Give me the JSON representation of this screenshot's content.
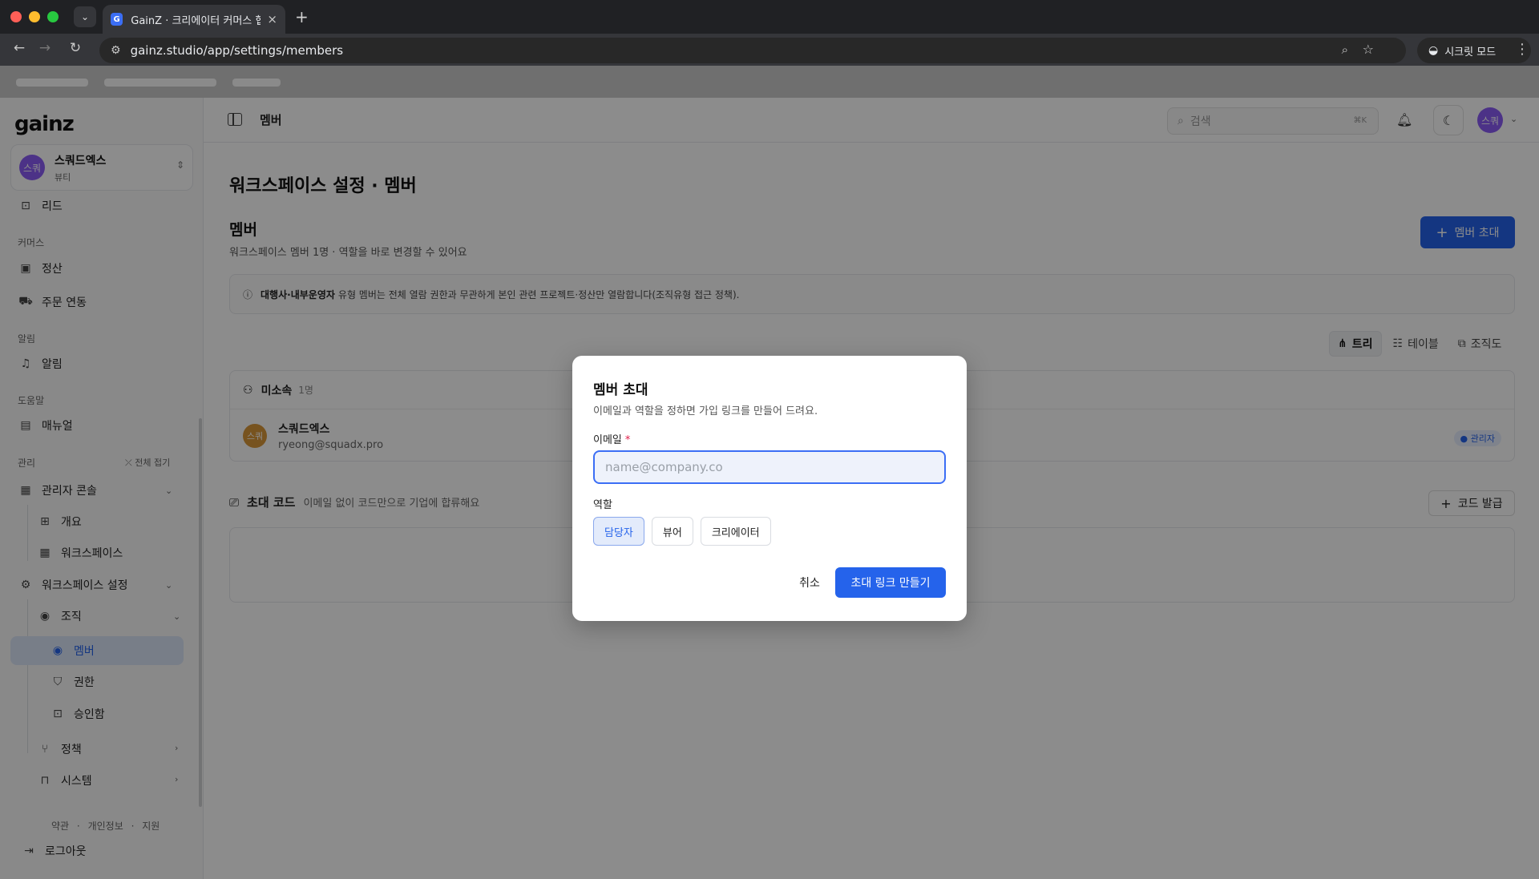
{
  "browser": {
    "tab_title": "GainZ · 크리에이터 커머스 협업 C",
    "tab_favicon": "G",
    "url": "gainz.studio/app/settings/members",
    "incognito_label": "시크릿 모드"
  },
  "sidebar": {
    "logo": "gainz",
    "workspace": {
      "avatar": "스쿼",
      "name": "스쿼드엑스",
      "sub": "뷰티"
    },
    "items": {
      "lead": "리드",
      "commerce_section": "커머스",
      "settlement": "정산",
      "order_sync": "주문 연동",
      "alert_section": "알림",
      "alerts": "알림",
      "help_section": "도움말",
      "manual": "매뉴얼",
      "manage_section": "관리",
      "collapse_all": "전체 접기",
      "admin_console": "관리자 콘솔",
      "overview": "개요",
      "workspace": "워크스페이스",
      "workspace_settings": "워크스페이스 설정",
      "org": "조직",
      "members": "멤버",
      "permissions": "권한",
      "approvals": "승인함",
      "policy": "정책",
      "system": "시스템"
    },
    "footer": {
      "terms": "약관",
      "privacy": "개인정보",
      "support": "지원",
      "sep": "·"
    },
    "logout": "로그아웃"
  },
  "topbar": {
    "breadcrumb": "멤버",
    "search_placeholder": "검색",
    "search_kbd": "⌘K",
    "user_avatar": "스쿼"
  },
  "page": {
    "title": "워크스페이스 설정 · 멤버",
    "section_title": "멤버",
    "section_sub": "워크스페이스 멤버 1명 · 역할을 바로 변경할 수 있어요",
    "invite_button": "멤버 초대",
    "notice_bold": "대행사·내부운영자",
    "notice_text": "유형 멤버는 전체 열람 권한과 무관하게 본인 관련 프로젝트·정산만 열람합니다(조직유형 접근 정책).",
    "view_tabs": {
      "tree": "트리",
      "table": "테이블",
      "org": "조직도"
    },
    "group_title": "미소속",
    "group_count": "1명",
    "member": {
      "avatar": "스쿼",
      "name": "스쿼드엑스",
      "email": "ryeong@squadx.pro",
      "role_badge": "● 관리자"
    },
    "code_title": "초대 코드",
    "code_sub": "이메일 없이 코드만으로 기업에 합류해요",
    "code_button": "코드 발급"
  },
  "modal": {
    "title": "멤버 초대",
    "description": "이메일과 역할을 정하면 가입 링크를 만들어 드려요.",
    "email_label": "이메일",
    "email_required": "*",
    "email_value": "",
    "email_placeholder": "name@company.co",
    "role_label": "역할",
    "roles": [
      "담당자",
      "뷰어",
      "크리에이터"
    ],
    "selected_role": "담당자",
    "cancel": "취소",
    "submit": "초대 링크 만들기"
  },
  "colors": {
    "accent": "#2563eb",
    "workspace_avatar": "#8b5cf6",
    "member_avatar": "#d9973a"
  }
}
